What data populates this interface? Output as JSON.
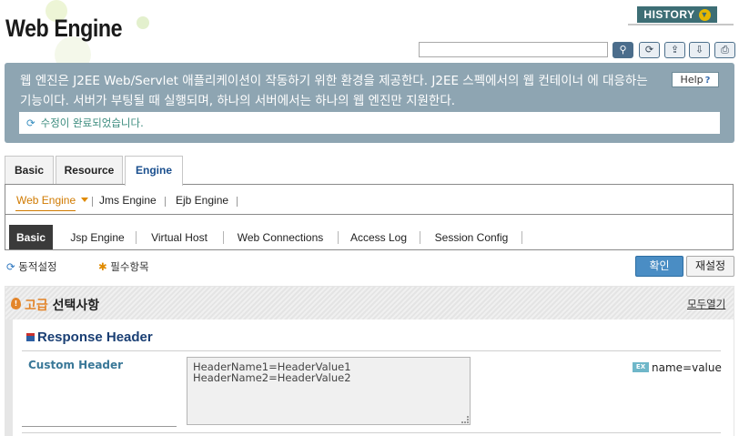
{
  "header": {
    "title": "Web Engine",
    "history_label": "HISTORY",
    "toolbar_icons": [
      "search-icon",
      "refresh-icon",
      "xml-export-icon",
      "xml-import-icon",
      "print-icon"
    ]
  },
  "description": {
    "text": "웹 엔진은 J2EE Web/Servlet 애플리케이션이 작동하기 위한 환경을 제공한다. J2EE 스펙에서의 웹 컨테이너 에 대응하는 기능이다. 서버가 부팅될 때 실행되며, 하나의 서버에서는 하나의 웹 엔진만 지원한다.",
    "help_label": "Help",
    "message": "수정이 완료되었습니다."
  },
  "tabs": {
    "level1": [
      "Basic",
      "Resource",
      "Engine"
    ],
    "level1_active": "Engine",
    "level2": [
      "Web Engine",
      "Jms Engine",
      "Ejb Engine"
    ],
    "level2_active": "Web Engine",
    "level3": [
      "Basic",
      "Jsp Engine",
      "Virtual Host",
      "Web Connections",
      "Access Log",
      "Session Config"
    ],
    "level3_active": "Basic"
  },
  "legend": {
    "dynamic_setting": "동적설정",
    "required_item": "필수항목"
  },
  "actions": {
    "confirm": "확인",
    "reset": "재설정"
  },
  "advanced": {
    "title_highlight": "고급",
    "title_rest": " 선택사항",
    "expand_all": "모두열기",
    "section_title": "Response Header",
    "field_label": "Custom Header",
    "field_value": "HeaderName1=HeaderValue1\nHeaderName2=HeaderValue2",
    "example_badge": "EX",
    "example_text": "name=value"
  },
  "colors": {
    "accent_blue": "#4a8dc4",
    "active_subtab": "#d07a00",
    "description_bg": "#8ea5b2",
    "history_bg": "#3d6e75"
  }
}
